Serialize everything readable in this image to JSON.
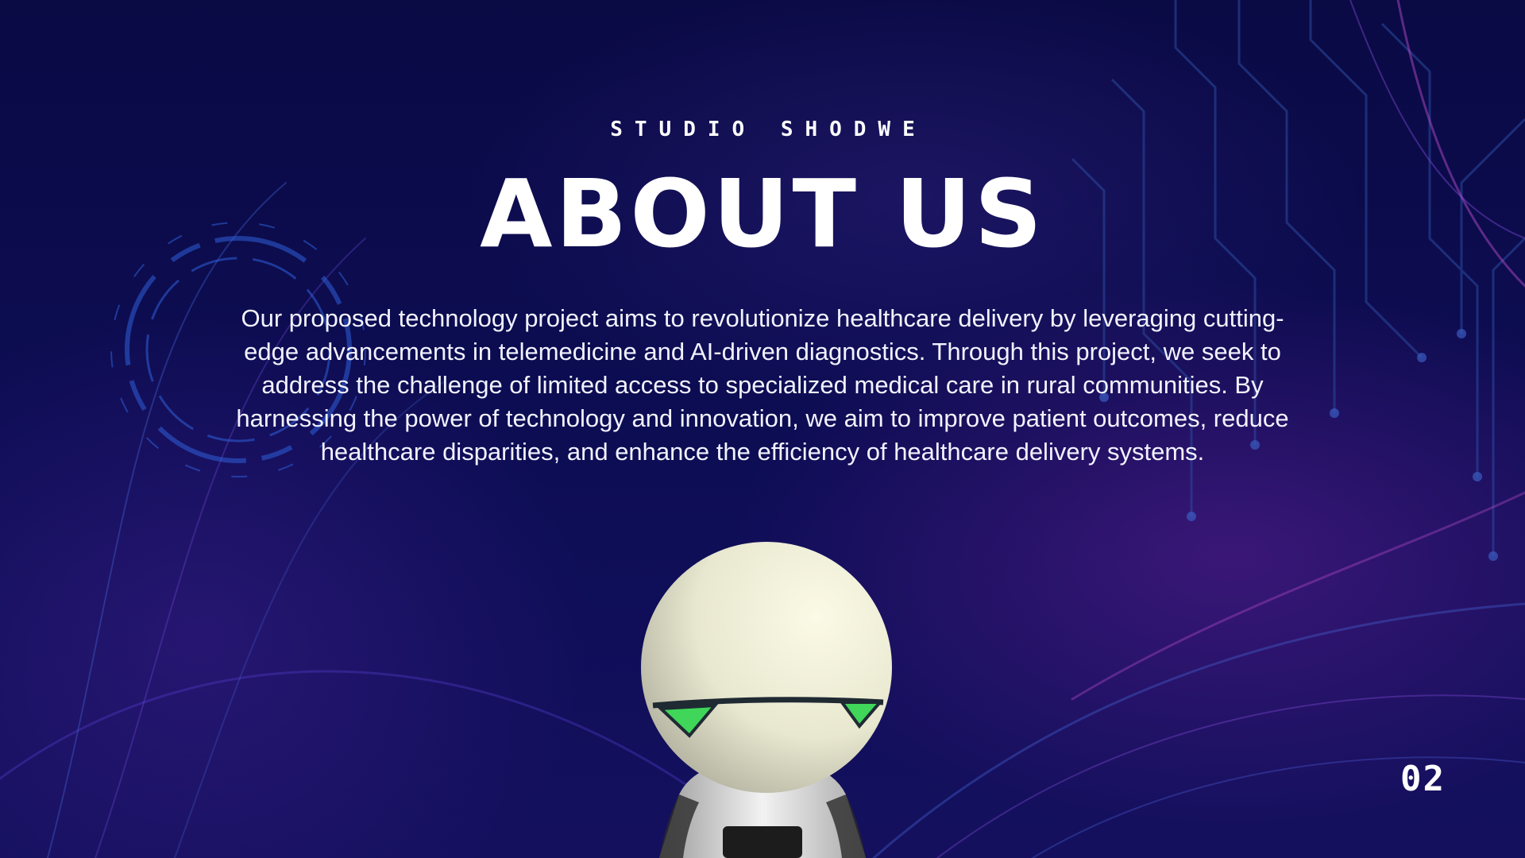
{
  "slide": {
    "brand": "STUDIO SHODWE",
    "title": "ABOUT US",
    "body": "Our proposed technology project aims to revolutionize healthcare delivery by leveraging cutting-edge advancements in telemedicine and AI-driven diagnostics. Through this project, we seek to address the challenge of limited access to specialized medical care in rural communities. By harnessing the power of technology and innovation, we aim to improve patient outcomes, reduce healthcare disparities, and enhance the efficiency of healthcare delivery systems.",
    "page_number": "02"
  },
  "illustration": {
    "icon": "robot-icon"
  },
  "colors": {
    "background": "#0b0b45",
    "text": "#ffffff",
    "accent_circuit": "#2d4fa8",
    "robot_eye": "#3fd65a"
  }
}
